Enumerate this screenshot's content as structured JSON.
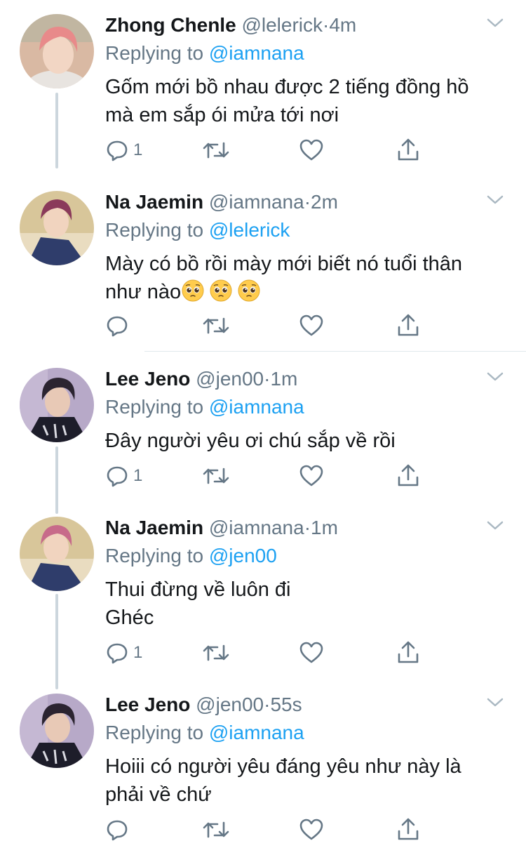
{
  "tweets": [
    {
      "name": "Zhong Chenle",
      "handle": "@lelerick",
      "dot": "·",
      "time": "4m",
      "replying_prefix": "Replying to",
      "replying_to": "@iamnana",
      "text_lines": [
        "Gốm mới bồ nhau được 2 tiếng đồng hồ",
        "mà em sắp ói mửa tới nơi"
      ],
      "reply_count": "1",
      "avatar_colors": {
        "bg": "#d9b9a3",
        "hair": "#e88a8a",
        "skin": "#f2d6c4",
        "shirt": "#e8e4e0"
      }
    },
    {
      "name": "Na Jaemin",
      "handle": "@iamnana",
      "dot": "·",
      "time": "2m",
      "replying_prefix": "Replying to",
      "replying_to": "@lelerick",
      "text_lines": [
        "Mày có bồ rồi mày mới biết nó tuổi thân",
        "như nào"
      ],
      "emoji": "pleading-face",
      "emoji_count": 3,
      "reply_count": "",
      "avatar_colors": {
        "bg": "#d8c69a",
        "hair": "#8a3a5a",
        "skin": "#f1d4bf",
        "shirt": "#2f3d6b"
      }
    },
    {
      "name": "Lee Jeno",
      "handle": "@jen00",
      "dot": "·",
      "time": "1m",
      "replying_prefix": "Replying to",
      "replying_to": "@iamnana",
      "text_lines": [
        "Đây người yêu ơi chú sắp về rồi"
      ],
      "reply_count": "1",
      "avatar_colors": {
        "bg": "#b7a9c8",
        "hair": "#2b2430",
        "skin": "#e8c9b6",
        "shirt": "#1d1d2a"
      }
    },
    {
      "name": "Na Jaemin",
      "handle": "@iamnana",
      "dot": "·",
      "time": "1m",
      "replying_prefix": "Replying to",
      "replying_to": "@jen00",
      "text_lines": [
        "Thui đừng về luôn đi",
        "Ghéc"
      ],
      "reply_count": "1",
      "avatar_colors": {
        "bg": "#d8c69a",
        "hair": "#c76b8a",
        "skin": "#f1d4bf",
        "shirt": "#2f3d6b"
      }
    },
    {
      "name": "Lee Jeno",
      "handle": "@jen00",
      "dot": "·",
      "time": "55s",
      "replying_prefix": "Replying to",
      "replying_to": "@iamnana",
      "text_lines": [
        "Hoiii có người yêu đáng yêu như này là",
        "phải về chứ"
      ],
      "reply_count": "",
      "avatar_colors": {
        "bg": "#b7a9c8",
        "hair": "#2b2430",
        "skin": "#e8c9b6",
        "shirt": "#1d1d2a"
      }
    }
  ],
  "icons": {
    "reply": "reply-icon",
    "retweet": "retweet-icon",
    "like": "heart-icon",
    "share": "share-icon",
    "more": "chevron-down-icon"
  },
  "colors": {
    "text": "#14171a",
    "muted": "#657786",
    "link": "#1da1f2",
    "line": "#ccd6dd"
  }
}
